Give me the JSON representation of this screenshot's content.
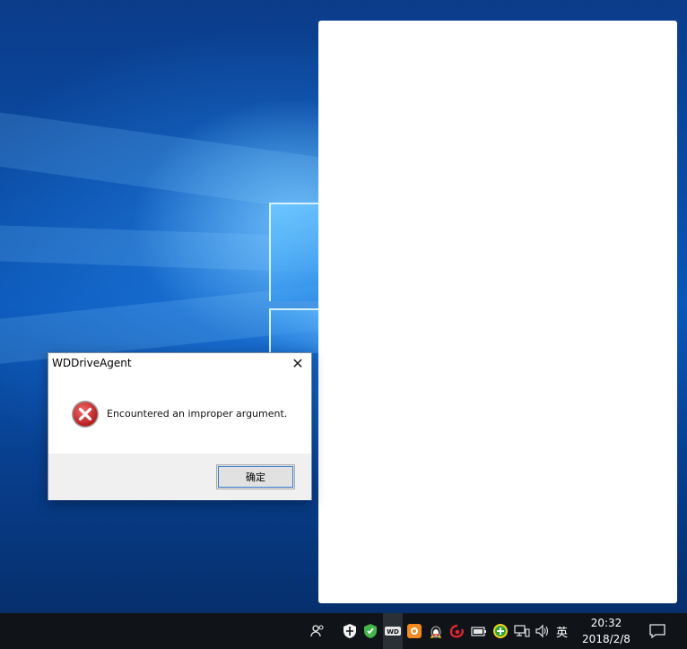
{
  "dialog": {
    "title": "WDDriveAgent",
    "message": "Encountered an improper argument.",
    "ok_label": "确定",
    "close_glyph": "✕",
    "icon": "error-icon"
  },
  "taskbar": {
    "ime_label": "英",
    "clock_time": "20:32",
    "clock_date": "2018/2/8",
    "tray_icons": [
      "people-icon",
      "windows-defender-icon",
      "security-shield-icon",
      "wd-drive-icon",
      "app-orange-icon",
      "qq-penguin-icon",
      "weibo-icon",
      "battery-icon",
      "green-plus-icon",
      "network-icon",
      "volume-icon"
    ],
    "notification_icon": "action-center-icon"
  },
  "colors": {
    "accent": "#3c7fd0",
    "error_red": "#d92b2b",
    "taskbar_bg": "#101418"
  }
}
